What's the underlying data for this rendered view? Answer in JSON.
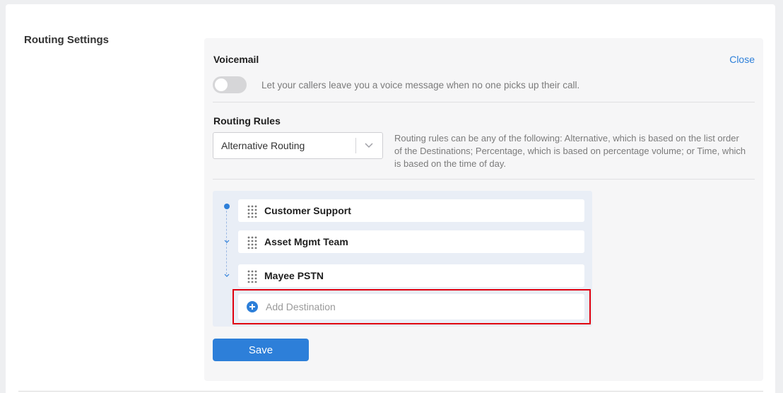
{
  "section": {
    "title": "Routing Settings"
  },
  "voicemail": {
    "title": "Voicemail",
    "close_label": "Close",
    "toggle_on": false,
    "description": "Let your callers leave you a voice message when no one picks up their call."
  },
  "routing_rules": {
    "title": "Routing Rules",
    "selected": "Alternative Routing",
    "description": "Routing rules can be any of the following: Alternative, which is based on the list order of the Destinations; Percentage, which is based on percentage volume; or Time, which is based on the time of day."
  },
  "destinations": {
    "items": [
      {
        "label": "Customer Support"
      },
      {
        "label": "Asset Mgmt Team"
      },
      {
        "label": "Mayee PSTN"
      }
    ],
    "add_label": "Add Destination"
  },
  "actions": {
    "save_label": "Save"
  },
  "colors": {
    "accent": "#2d7fd9",
    "highlight": "#e0000f"
  }
}
